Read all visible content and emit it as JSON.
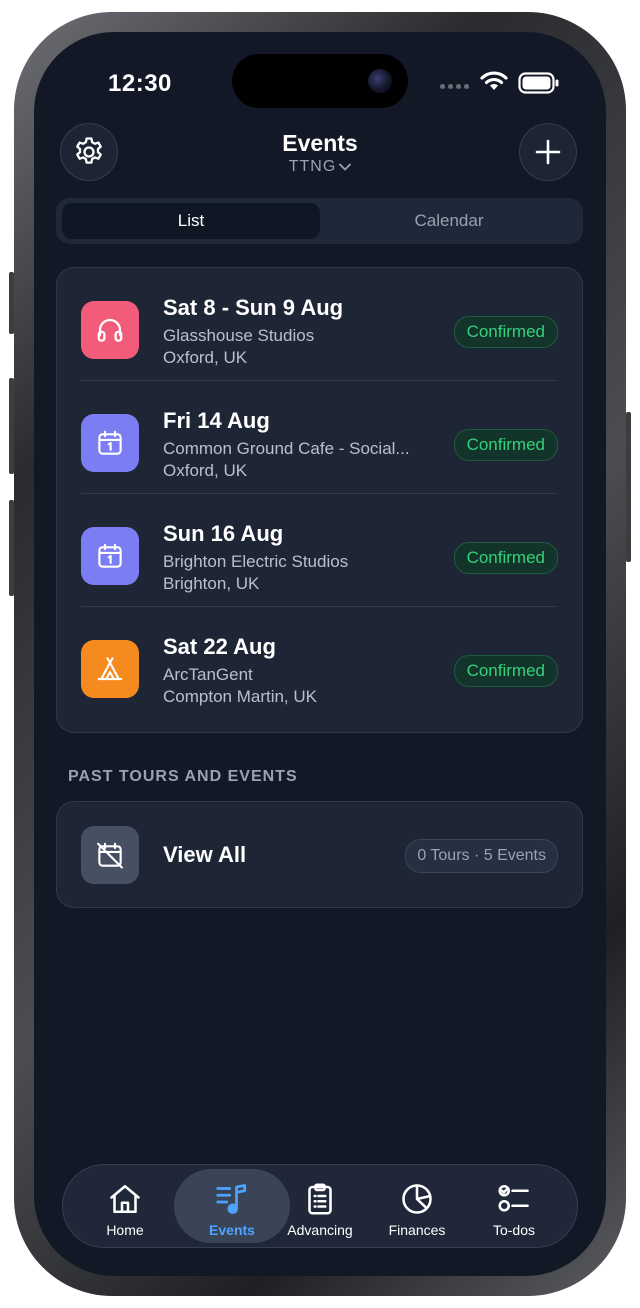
{
  "status_bar": {
    "time": "12:30"
  },
  "header": {
    "title": "Events",
    "subtitle": "TTNG"
  },
  "segmented": {
    "list_label": "List",
    "calendar_label": "Calendar"
  },
  "events": [
    {
      "date": "Sat 8 - Sun 9 Aug",
      "venue": "Glasshouse Studios",
      "location": "Oxford, UK",
      "status": "Confirmed",
      "icon": "headphones-icon",
      "icon_color": "#f25c7a"
    },
    {
      "date": "Fri 14 Aug",
      "venue": "Common Ground Cafe - Social...",
      "location": "Oxford, UK",
      "status": "Confirmed",
      "icon": "calendar-icon",
      "icon_color": "#7b7ef2"
    },
    {
      "date": "Sun 16 Aug",
      "venue": "Brighton Electric Studios",
      "location": "Brighton, UK",
      "status": "Confirmed",
      "icon": "calendar-icon",
      "icon_color": "#7b7ef2"
    },
    {
      "date": "Sat 22 Aug",
      "venue": "ArcTanGent",
      "location": "Compton Martin, UK",
      "status": "Confirmed",
      "icon": "tent-icon",
      "icon_color": "#f58a1f"
    }
  ],
  "past": {
    "section_label": "PAST TOURS AND EVENTS",
    "view_all_label": "View All",
    "counts": "0 Tours · 5 Events"
  },
  "tabbar": {
    "tabs": [
      {
        "label": "Home",
        "icon": "home-icon"
      },
      {
        "label": "Events",
        "icon": "music-list-icon",
        "active": true
      },
      {
        "label": "Advancing",
        "icon": "clipboard-icon"
      },
      {
        "label": "Finances",
        "icon": "pie-chart-icon"
      },
      {
        "label": "To-dos",
        "icon": "checklist-icon"
      }
    ]
  },
  "colors": {
    "background": "#121826",
    "card": "#1e2636",
    "accent": "#4fa3ff",
    "confirmed": "#32d27a"
  }
}
